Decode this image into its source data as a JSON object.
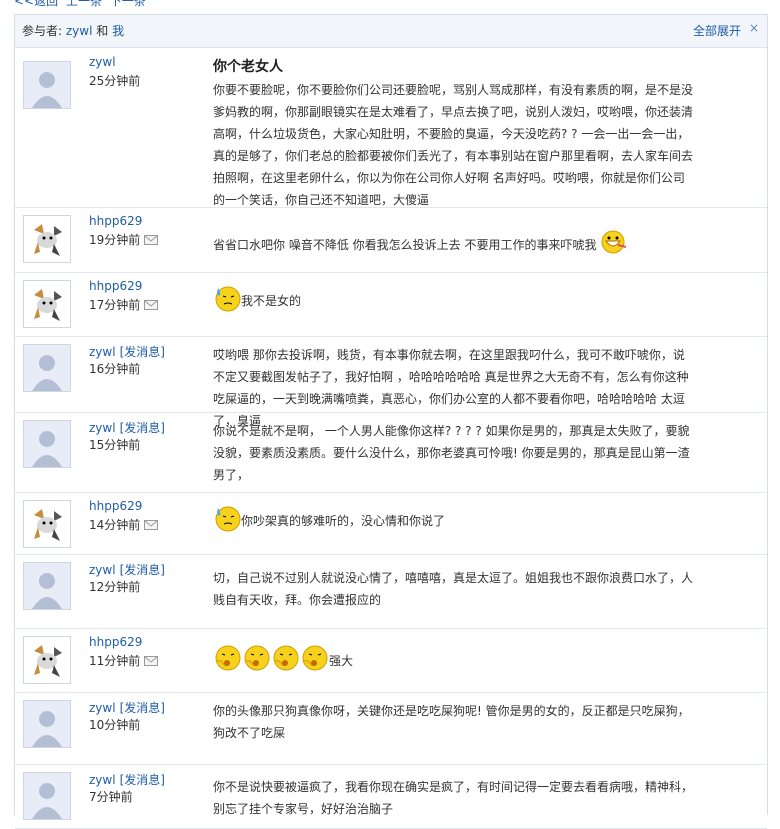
{
  "nav": {
    "back": "<<返回",
    "prev": "上一条",
    "next": "下一条"
  },
  "header": {
    "participants_label": "参与者:",
    "p1": "zywl",
    "and": "和",
    "p2": "我",
    "expand_all": "全部展开",
    "close": "×"
  },
  "messages": [
    {
      "user": "zywl",
      "send": "",
      "time": "25分钟前",
      "title": "你个老女人",
      "text": "你要不要脸呢，你不要脸你们公司还要脸呢，骂别人骂成那样，有没有素质的啊，是不是没爹妈教的啊，你那副眼镜实在是太难看了，早点去换了吧，说别人泼妇，哎哟喂，你还装清高啊，什么垃圾货色，大家心知肚明，不要脸的臭逼，今天没吃药? ? 一会一出一会一出，真的是够了，你们老总的脸都要被你们丢光了，有本事别站在窗户那里看啊，去人家车间去拍照啊，在这里老卵什么，你以为你在公司你人好啊 名声好吗。哎哟喂，你就是你们公司的一个笑话，你自己还不知道吧，大傻逼"
    },
    {
      "user": "hhpp629",
      "send": "",
      "time": "19分钟前",
      "title": "",
      "text": "省省口水吧你 噪音不降低 你看我怎么投诉上去 不要用工作的事来吓唬我"
    },
    {
      "user": "hhpp629",
      "send": "",
      "time": "17分钟前",
      "title": "",
      "text": "我不是女的"
    },
    {
      "user": "zywl",
      "send": "[发消息]",
      "time": "16分钟前",
      "title": "",
      "text": "哎哟喂 那你去投诉啊，贱货，有本事你就去啊，在这里跟我叼什么，我可不敢吓唬你，说不定又要截图发帖子了，我好怕啊 ，哈哈哈哈哈哈 真是世界之大无奇不有，怎么有你这种吃屎逼的，一天到晚满嘴喷粪，真恶心，你们办公室的人都不要看你吧，哈哈哈哈哈  太逗了，臭逼"
    },
    {
      "user": "zywl",
      "send": "[发消息]",
      "time": "15分钟前",
      "title": "",
      "text": "你说不是就不是啊，  一个人男人能像你这样? ? ? ? 如果你是男的，那真是太失败了，要貌没貌，要素质没素质。要什么没什么，那你老婆真可怜哦!  你要是男的，那真是昆山第一渣男了，"
    },
    {
      "user": "hhpp629",
      "send": "",
      "time": "14分钟前",
      "title": "",
      "text": "你吵架真的够难听的，没心情和你说了"
    },
    {
      "user": "zywl",
      "send": "[发消息]",
      "time": "12分钟前",
      "title": "",
      "text": "切，自己说不过别人就说没心情了，嘻嘻嘻，真是太逗了。姐姐我也不跟你浪费口水了，人贱自有天收，拜。你会遭报应的"
    },
    {
      "user": "hhpp629",
      "send": "",
      "time": "11分钟前",
      "title": "",
      "text": "强大"
    },
    {
      "user": "zywl",
      "send": "[发消息]",
      "time": "10分钟前",
      "title": "",
      "text": "你的头像那只狗真像你呀，关键你还是吃吃屎狗呢! 管你是男的女的，反正都是只吃屎狗，狗改不了吃屎"
    },
    {
      "user": "zywl",
      "send": "[发消息]",
      "time": "7分钟前",
      "title": "",
      "text": "你不是说快要被逼疯了，我看你现在确实是疯了，有时间记得一定要去看看病哦，精神科，  别忘了挂个专家号，好好治治脑子"
    }
  ],
  "colors": {
    "link": "#1f5ca8",
    "text": "#333333",
    "header_bg": "#f2f5f9",
    "border": "#e4e8ee"
  }
}
